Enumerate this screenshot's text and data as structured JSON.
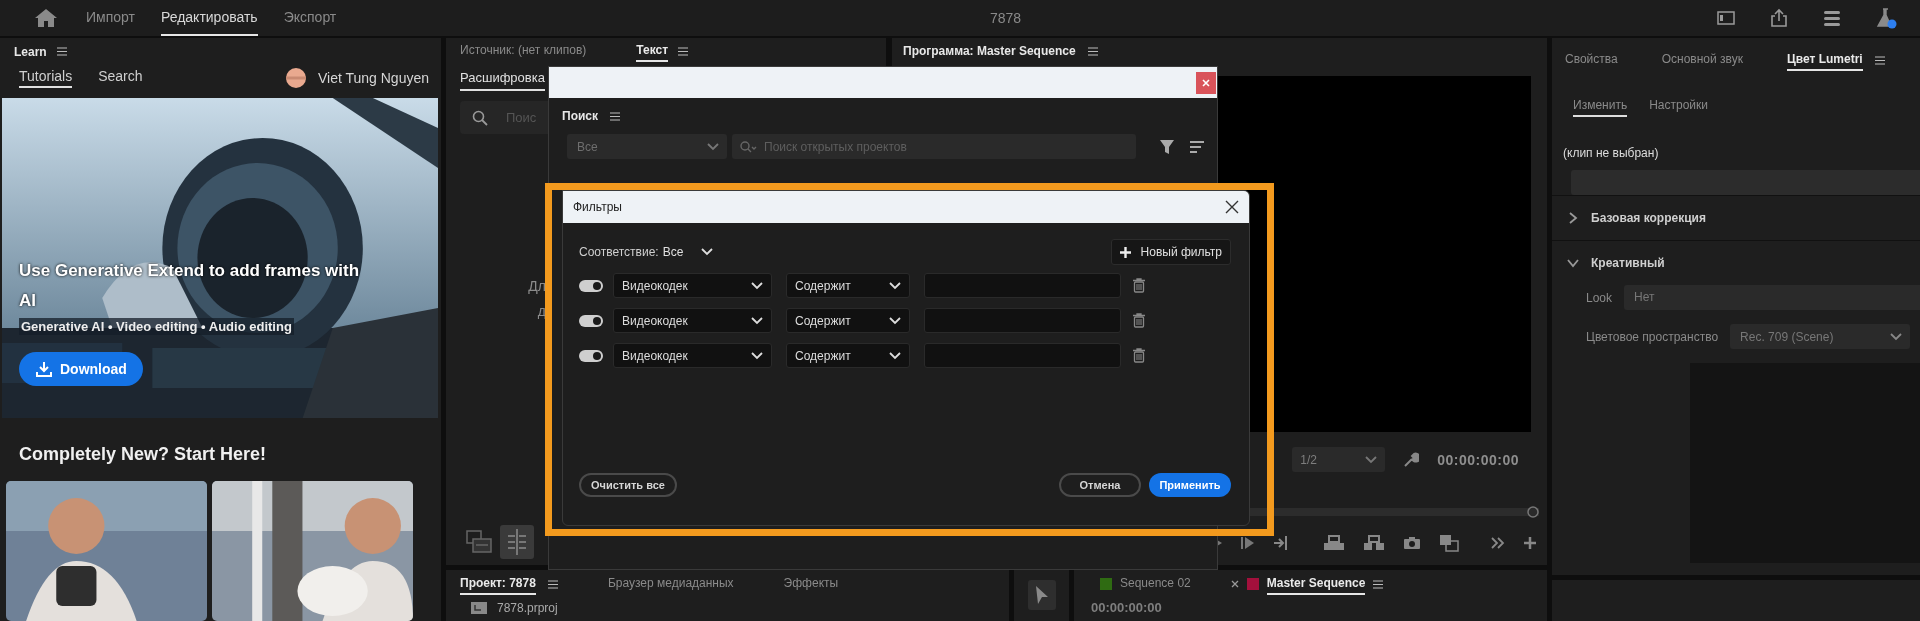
{
  "header": {
    "nav": [
      {
        "label": "Импорт",
        "selected": false
      },
      {
        "label": "Редактировать",
        "selected": true
      },
      {
        "label": "Экспорт",
        "selected": false
      }
    ],
    "title": "7878"
  },
  "learn_panel": {
    "title": "Learn",
    "tabs": [
      {
        "label": "Tutorials",
        "selected": true
      },
      {
        "label": "Search",
        "selected": false
      }
    ],
    "user": "Viet Tung Nguyen",
    "hero": {
      "kind": "picture",
      "title": "Use Generative Extend to add frames with AI",
      "tags": "Generative AI • Video editing • Audio editing",
      "button": "Download"
    },
    "section_title": "Completely New? Start Here!"
  },
  "source_panel": {
    "tabs": [
      {
        "label": "Источник: (нет клипов)",
        "selected": false
      },
      {
        "label": "Текст",
        "selected": true
      }
    ],
    "subtab": "Расшифровка",
    "search_placeholder": "Поис",
    "hint_lines": [
      "Дл",
      "д"
    ]
  },
  "program_panel": {
    "title": "Программа: Master Sequence",
    "zoom": "1/2",
    "timecode": "00:00:00:00"
  },
  "properties_panel": {
    "tabs": [
      {
        "label": "Свойства",
        "selected": false
      },
      {
        "label": "Основной звук",
        "selected": false
      },
      {
        "label": "Цвет Lumetri",
        "selected": true
      }
    ],
    "subtabs": [
      {
        "label": "Изменить",
        "selected": true
      },
      {
        "label": "Настройки",
        "selected": false
      }
    ],
    "clip_label": "(клип не выбран)",
    "sections": [
      {
        "title": "Базовая коррекция",
        "expanded": false
      },
      {
        "title": "Креативный",
        "expanded": true
      }
    ],
    "look_label": "Look",
    "look_value": "Нет",
    "color_space_label": "Цветовое пространство",
    "color_space_value": "Rec. 709 (Scene)"
  },
  "project_panel": {
    "tabs": [
      {
        "label": "Проект: 7878",
        "selected": true
      },
      {
        "label": "Браузер медиаданных",
        "selected": false
      },
      {
        "label": "Эффекты",
        "selected": false
      }
    ],
    "file": "7878.prproj"
  },
  "timeline_panel": {
    "tabs": [
      {
        "label": "Sequence 02",
        "color": "#2f6b12",
        "selected": false,
        "closable": false
      },
      {
        "label": "Master Sequence",
        "color": "#a3103c",
        "selected": true,
        "closable": true
      }
    ],
    "timecode": "00:00:00:00"
  },
  "search_dialog": {
    "title": "Поиск",
    "scope": "Все",
    "placeholder": "Поиск открытых проектов"
  },
  "filters_dialog": {
    "highlighted": true,
    "title": "Фильтры",
    "match_label": "Соответствие:",
    "match_value": "Все",
    "new_filter": "Новый фильтр",
    "rules": [
      {
        "on": true,
        "field": "Видеокодек",
        "operator": "Содержит"
      },
      {
        "on": true,
        "field": "Видеокодек",
        "operator": "Содержит"
      },
      {
        "on": true,
        "field": "Видеокодек",
        "operator": "Содержит"
      }
    ],
    "clear_button": "Очистить все",
    "cancel_button": "Отмена",
    "apply_button": "Применить"
  }
}
